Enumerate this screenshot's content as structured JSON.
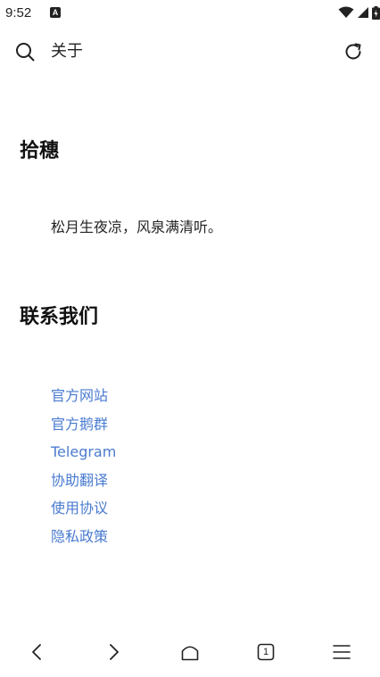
{
  "status_bar": {
    "time": "9:52",
    "notification_badge": "A"
  },
  "toolbar": {
    "title": "关于",
    "search_icon": "search-icon",
    "reload_icon": "reload-icon"
  },
  "sections": {
    "about": {
      "heading": "拾穗",
      "text": "松月生夜凉，风泉满清听。"
    },
    "contact": {
      "heading": "联系我们",
      "links": [
        "官方网站",
        "官方鹅群",
        "Telegram",
        "协助翻译",
        "使用协议",
        "隐私政策"
      ]
    }
  },
  "bottom_nav": {
    "tab_count": "1",
    "icons": [
      "back-icon",
      "forward-icon",
      "home-icon",
      "tabs-icon",
      "menu-icon"
    ]
  },
  "colors": {
    "link": "#4a7bd0",
    "text": "#222222",
    "background": "#ffffff"
  }
}
